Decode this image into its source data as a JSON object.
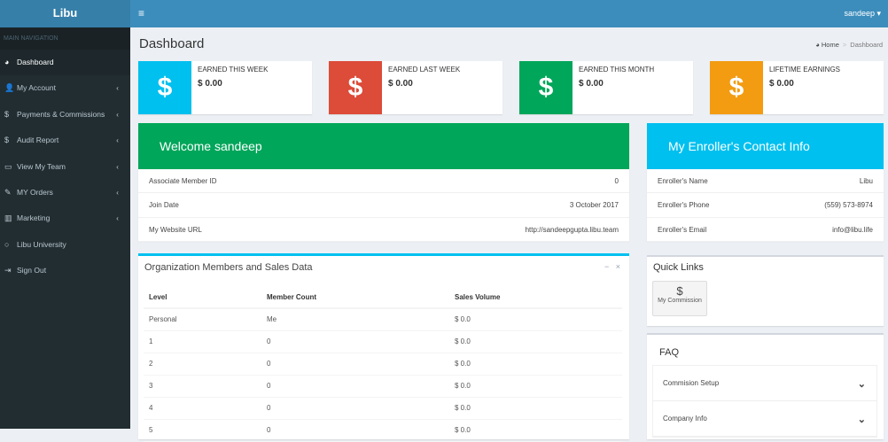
{
  "app": {
    "logo": "Libu",
    "user": "sandeep ▾",
    "menu_icon": "≡"
  },
  "sidebar": {
    "header": "MAIN NAVIGATION",
    "items": [
      {
        "label": "Dashboard",
        "icon": "◕",
        "chev": ""
      },
      {
        "label": "My Account",
        "icon": "👤",
        "chev": "‹"
      },
      {
        "label": "Payments & Commissions",
        "icon": "$",
        "chev": "‹"
      },
      {
        "label": "Audit Report",
        "icon": "$",
        "chev": "‹"
      },
      {
        "label": "View My Team",
        "icon": "▭",
        "chev": "‹"
      },
      {
        "label": "MY Orders",
        "icon": "✎",
        "chev": "‹"
      },
      {
        "label": "Marketing",
        "icon": "▥",
        "chev": "‹"
      },
      {
        "label": "Libu University",
        "icon": "○",
        "chev": ""
      },
      {
        "label": "Sign Out",
        "icon": "⇥",
        "chev": ""
      }
    ]
  },
  "page": {
    "title": "Dashboard",
    "breadcrumb": {
      "home": "Home",
      "sep": ">",
      "current": "Dashboard"
    }
  },
  "info_boxes": [
    {
      "label": "EARNED THIS WEEK",
      "value": "$ 0.00",
      "icon": "$",
      "color": "#00c0ef"
    },
    {
      "label": "EARNED LAST WEEK",
      "value": "$ 0.00",
      "icon": "$",
      "color": "#dd4b39"
    },
    {
      "label": "EARNED THIS MONTH",
      "value": "$ 0.00",
      "icon": "$",
      "color": "#00a65a"
    },
    {
      "label": "LIFETIME EARNINGS",
      "value": "$ 0.00",
      "icon": "$",
      "color": "#f39c12"
    }
  ],
  "welcome": {
    "title": "Welcome sandeep",
    "rows": [
      {
        "k": "Associate Member ID",
        "v": "0"
      },
      {
        "k": "Join Date",
        "v": "3 October 2017"
      },
      {
        "k": "My Website URL",
        "v": "http://sandeepgupta.libu.team"
      }
    ]
  },
  "enroller": {
    "title": "My Enroller's Contact Info",
    "rows": [
      {
        "k": "Enroller's Name",
        "v": "Libu"
      },
      {
        "k": "Enroller's Phone",
        "v": "(559) 573-8974"
      },
      {
        "k": "Enroller's Email",
        "v": "info@libu.life"
      }
    ]
  },
  "org": {
    "title": "Organization Members and Sales Data",
    "minimize": "−",
    "close": "×",
    "columns": [
      "Level",
      "Member Count",
      "Sales Volume"
    ],
    "rows": [
      [
        "Personal",
        "Me",
        "$ 0.0"
      ],
      [
        "1",
        "0",
        "$ 0.0"
      ],
      [
        "2",
        "0",
        "$ 0.0"
      ],
      [
        "3",
        "0",
        "$ 0.0"
      ],
      [
        "4",
        "0",
        "$ 0.0"
      ],
      [
        "5",
        "0",
        "$ 0.0"
      ]
    ]
  },
  "quick_links": {
    "title": "Quick Links",
    "items": [
      {
        "icon": "$",
        "label": "My Commission"
      }
    ]
  },
  "faq": {
    "title": "FAQ",
    "items": [
      "Commision Setup",
      "Company Info"
    ],
    "chevron": "⌄"
  }
}
